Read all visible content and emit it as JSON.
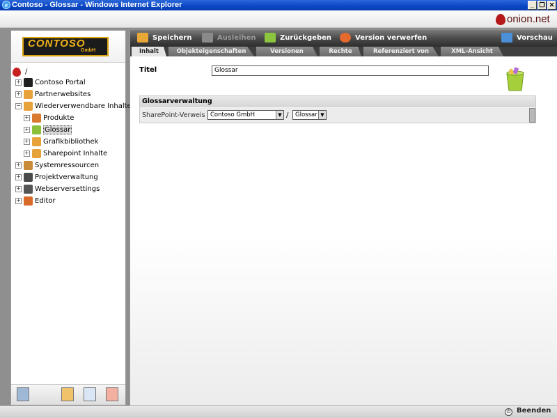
{
  "window": {
    "title": "Contoso - Glossar - Windows Internet Explorer",
    "icon": "ie-icon",
    "buttons": [
      "minimize",
      "restore",
      "close"
    ]
  },
  "app": {
    "brand": "onion.net",
    "logo": "CONTOSO",
    "logo_sub": "GmbH"
  },
  "tree": {
    "root": "/",
    "nodes": [
      {
        "label": "Contoso Portal",
        "icon": "contoso-icon",
        "level": 1,
        "color": "#1e1e1e"
      },
      {
        "label": "Partnerwebsites",
        "icon": "folder-icon",
        "level": 1,
        "color": "#e8a23b"
      },
      {
        "label": "Wiederverwendbare Inhalte",
        "icon": "folder-icon",
        "level": 1,
        "color": "#e8a23b",
        "expanded": true
      },
      {
        "label": "Produkte",
        "icon": "product-icon",
        "level": 2,
        "color": "#d97a2e"
      },
      {
        "label": "Glossar",
        "icon": "glossary-icon",
        "level": 2,
        "color": "#8cbf3a",
        "selected": true
      },
      {
        "label": "Grafikbibliothek",
        "icon": "folder-icon",
        "level": 2,
        "color": "#e8a23b"
      },
      {
        "label": "Sharepoint Inhalte",
        "icon": "folder-icon",
        "level": 2,
        "color": "#e8a23b"
      },
      {
        "label": "Systemressourcen",
        "icon": "system-icon",
        "level": 1,
        "color": "#c98b3a"
      },
      {
        "label": "Projektverwaltung",
        "icon": "project-icon",
        "level": 1,
        "color": "#4a4a4a"
      },
      {
        "label": "Webserversettings",
        "icon": "server-icon",
        "level": 1,
        "color": "#555555"
      },
      {
        "label": "Editor",
        "icon": "editor-icon",
        "level": 1,
        "color": "#d96a2a"
      }
    ]
  },
  "toolbar": {
    "save": "Speichern",
    "checkout": "Ausleihen",
    "checkin": "Zurückgeben",
    "discard": "Version verwerfen",
    "preview": "Vorschau"
  },
  "tabs": [
    {
      "label": "Inhalt",
      "active": true
    },
    {
      "label": "Objekteigenschaften"
    },
    {
      "label": "Versionen"
    },
    {
      "label": "Rechte"
    },
    {
      "label": "Referenziert von"
    },
    {
      "label": "XML-Ansicht"
    }
  ],
  "form": {
    "title_label": "Titel",
    "title_value": "Glossar",
    "section_title": "Glossarverwaltung",
    "sharepoint_label": "SharePoint-Verweis",
    "sharepoint_site": "Contoso GmbH",
    "separator": "/",
    "sharepoint_list": "Glossar"
  },
  "status": {
    "exit": "Beenden"
  },
  "colors": {
    "titlebar": "#0a46c4",
    "toolbar": "#4a4a4a",
    "brand": "#b51818",
    "logo_gold": "#f0b21a"
  }
}
